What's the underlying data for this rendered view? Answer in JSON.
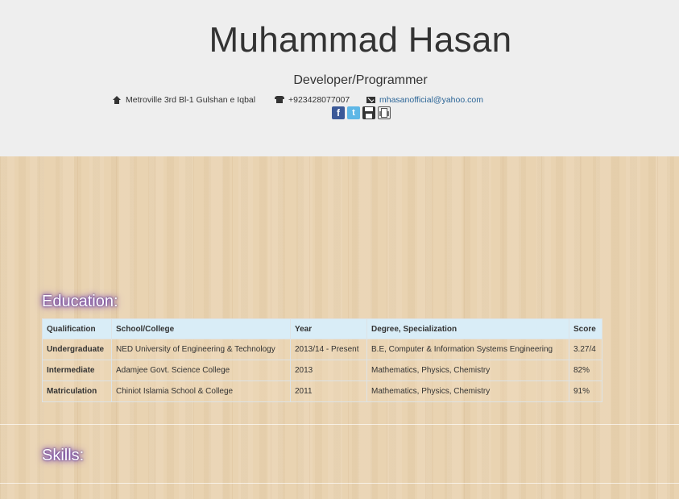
{
  "profile": {
    "name": "Muhammad Hasan",
    "role": "Developer/Programmer",
    "address": "Metroville 3rd Bl-1 Gulshan e Iqbal",
    "phone": "+923428077007",
    "email": "mhasanofficial@yahoo.com"
  },
  "social_icons": [
    "facebook-icon",
    "twitter-icon",
    "save-icon",
    "print-icon"
  ],
  "education": {
    "title": "Education:",
    "headers": [
      "Qualification",
      "School/College",
      "Year",
      "Degree, Specialization",
      "Score"
    ],
    "rows": [
      {
        "qualification": "Undergraduate",
        "school": "NED University of Engineering & Technology",
        "year": "2013/14 - Present",
        "degree": "B.E, Computer & Information Systems Engineering",
        "score": "3.27/4"
      },
      {
        "qualification": "Intermediate",
        "school": "Adamjee Govt. Science College",
        "year": "2013",
        "degree": "Mathematics, Physics, Chemistry",
        "score": "82%"
      },
      {
        "qualification": "Matriculation",
        "school": "Chiniot Islamia School & College",
        "year": "2011",
        "degree": "Mathematics, Physics, Chemistry",
        "score": "91%"
      }
    ]
  },
  "skills": {
    "title": "Skills:"
  },
  "colors": {
    "header_bg": "#eeeeee",
    "wood_bg": "#e9d3b1",
    "table_header_bg": "#d9edf7",
    "link": "#2a6496",
    "title_glow": "#7e44c8"
  }
}
